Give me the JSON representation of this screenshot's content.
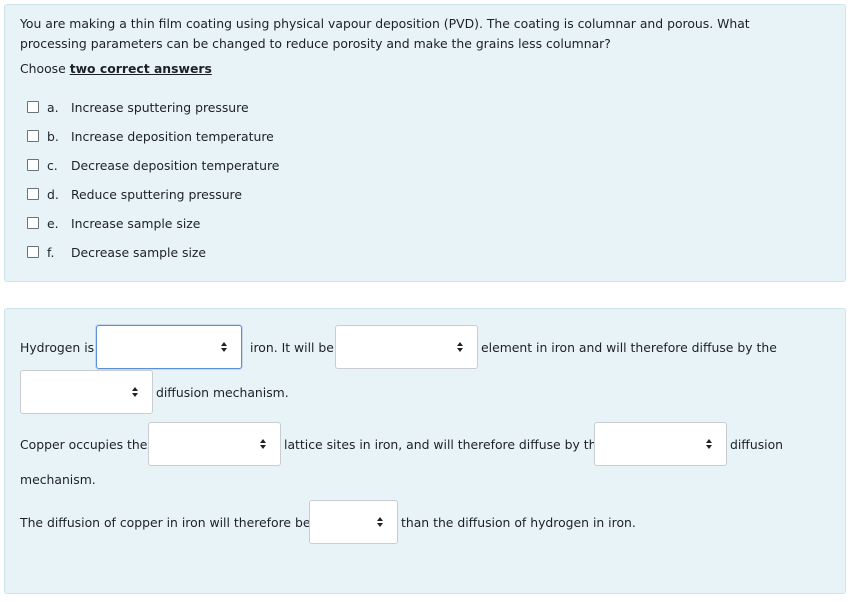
{
  "q1": {
    "text": "You are making a thin film coating using physical vapour deposition (PVD). The coating is columnar and porous. What processing parameters can be changed to reduce porosity and make the grains less columnar?",
    "choose_prefix": "Choose ",
    "choose_bold": "two correct answers",
    "options": [
      {
        "letter": "a.",
        "label": "Increase sputtering pressure"
      },
      {
        "letter": "b.",
        "label": "Increase deposition temperature"
      },
      {
        "letter": "c.",
        "label": "Decrease deposition temperature"
      },
      {
        "letter": "d.",
        "label": "Reduce sputtering pressure"
      },
      {
        "letter": "e.",
        "label": "Increase sample size"
      },
      {
        "letter": "f.",
        "label": "Decrease sample size"
      }
    ]
  },
  "q2": {
    "hydrogen_is": "Hydrogen is",
    "iron_will_be": "iron. It will be",
    "element_in_iron": "element in iron and will therefore diffuse by the",
    "diffusion_mechanism": "diffusion mechanism.",
    "copper_occupies": "Copper occupies the",
    "lattice_sites": "lattice sites in iron, and will therefore diffuse by the",
    "diffusion": "diffusion",
    "mechanism": "mechanism.",
    "diffusion_of_copper": "The diffusion of  copper in iron will therefore be",
    "than_diffusion": "than the diffusion of hydrogen in iron."
  }
}
